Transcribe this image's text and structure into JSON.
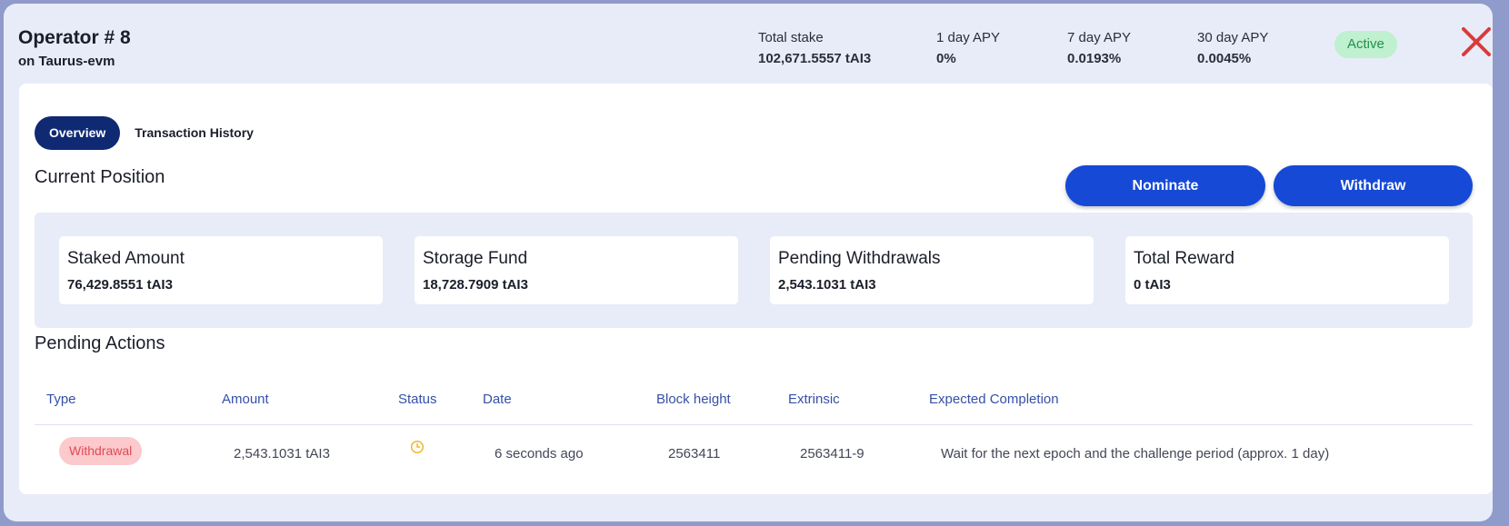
{
  "header": {
    "title": "Operator # 8",
    "subtitle": "on Taurus-evm",
    "stats": [
      {
        "label": "Total stake",
        "value": "102,671.5557 tAI3"
      },
      {
        "label": "1 day APY",
        "value": "0%"
      },
      {
        "label": "7 day APY",
        "value": "0.0193%"
      },
      {
        "label": "30 day APY",
        "value": "0.0045%"
      }
    ],
    "status": "Active",
    "status_color": "#23904a",
    "close_icon": "close-x-icon",
    "close_color": "#d93b3b"
  },
  "tabs": [
    {
      "label": "Overview",
      "active": true
    },
    {
      "label": "Transaction History",
      "active": false
    }
  ],
  "current_position": {
    "title": "Current Position",
    "nominate_label": "Nominate",
    "withdraw_label": "Withdraw",
    "cards": [
      {
        "title": "Staked Amount",
        "value": "76,429.8551 tAI3"
      },
      {
        "title": "Storage Fund",
        "value": "18,728.7909 tAI3"
      },
      {
        "title": "Pending Withdrawals",
        "value": "2,543.1031 tAI3"
      },
      {
        "title": "Total Reward",
        "value": "0 tAI3"
      }
    ]
  },
  "pending_actions": {
    "title": "Pending Actions",
    "columns": [
      "Type",
      "Amount",
      "Status",
      "Date",
      "Block height",
      "Extrinsic",
      "Expected Completion"
    ],
    "rows": [
      {
        "type": "Withdrawal",
        "amount": "2,543.1031 tAI3",
        "status_icon": "clock-icon",
        "date": "6 seconds ago",
        "block_height": "2563411",
        "extrinsic": "2563411-9",
        "expected_completion": "Wait for the next epoch and the challenge period (approx. 1 day)"
      }
    ]
  },
  "colors": {
    "primary_button": "#1649d6",
    "active_tab": "#0f2a73",
    "pending_badge": "#fcc9cc",
    "clock": "#f0b72f"
  }
}
